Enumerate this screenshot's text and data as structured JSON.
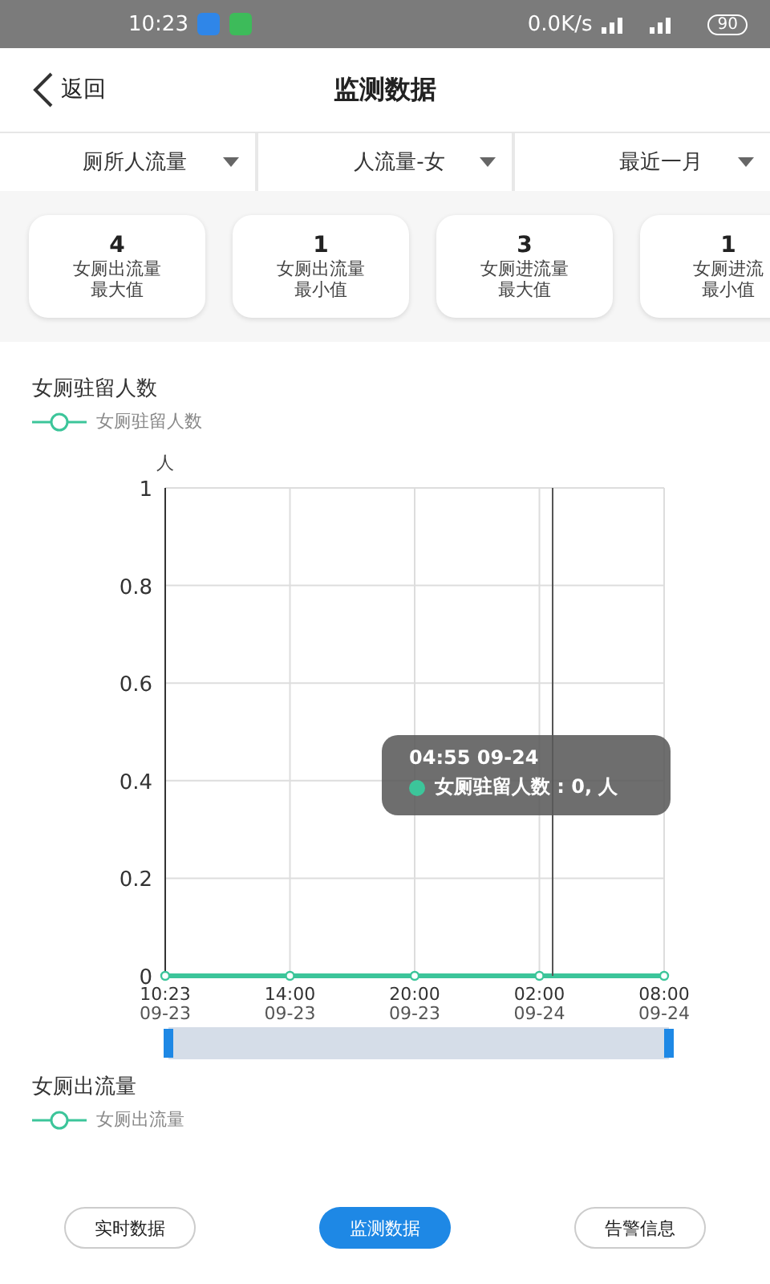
{
  "status_bar": {
    "time": "10:23",
    "speed": "0.0K/s",
    "battery": "90"
  },
  "header": {
    "back": "返回",
    "title": "监测数据"
  },
  "filters": [
    {
      "label": "厕所人流量"
    },
    {
      "label": "人流量-女"
    },
    {
      "label": "最近一月"
    }
  ],
  "stats": [
    {
      "value": "4",
      "line1": "女厕出流量",
      "line2": "最大值"
    },
    {
      "value": "1",
      "line1": "女厕出流量",
      "line2": "最小值"
    },
    {
      "value": "3",
      "line1": "女厕进流量",
      "line2": "最大值"
    },
    {
      "value": "1",
      "line1": "女厕进流",
      "line2": "最小值"
    }
  ],
  "chart_section": {
    "title": "女厕驻留人数",
    "chart_data": {
      "type": "line",
      "ylabel": "人",
      "ylim": [
        0,
        1
      ],
      "grid": true,
      "categories": [
        "10:23 09-23",
        "14:00 09-23",
        "20:00 09-23",
        "02:00 09-24",
        "08:00 09-24"
      ],
      "yticks": [
        0,
        0.2,
        0.4,
        0.6,
        0.8,
        1
      ],
      "series": [
        {
          "name": "女厕驻留人数",
          "color": "#3cc59a",
          "marker": "circle",
          "values": [
            0,
            0,
            0,
            0,
            0
          ]
        }
      ]
    },
    "tooltip": {
      "title": "04:55 09-24",
      "text": "女厕驻留人数 : 0, 人"
    }
  },
  "second_section": {
    "title": "女厕出流量",
    "legend": "女厕出流量"
  },
  "nav_buttons": [
    {
      "label": "实时数据",
      "selected": false
    },
    {
      "label": "监测数据",
      "selected": true
    },
    {
      "label": "告警信息",
      "selected": false
    }
  ]
}
